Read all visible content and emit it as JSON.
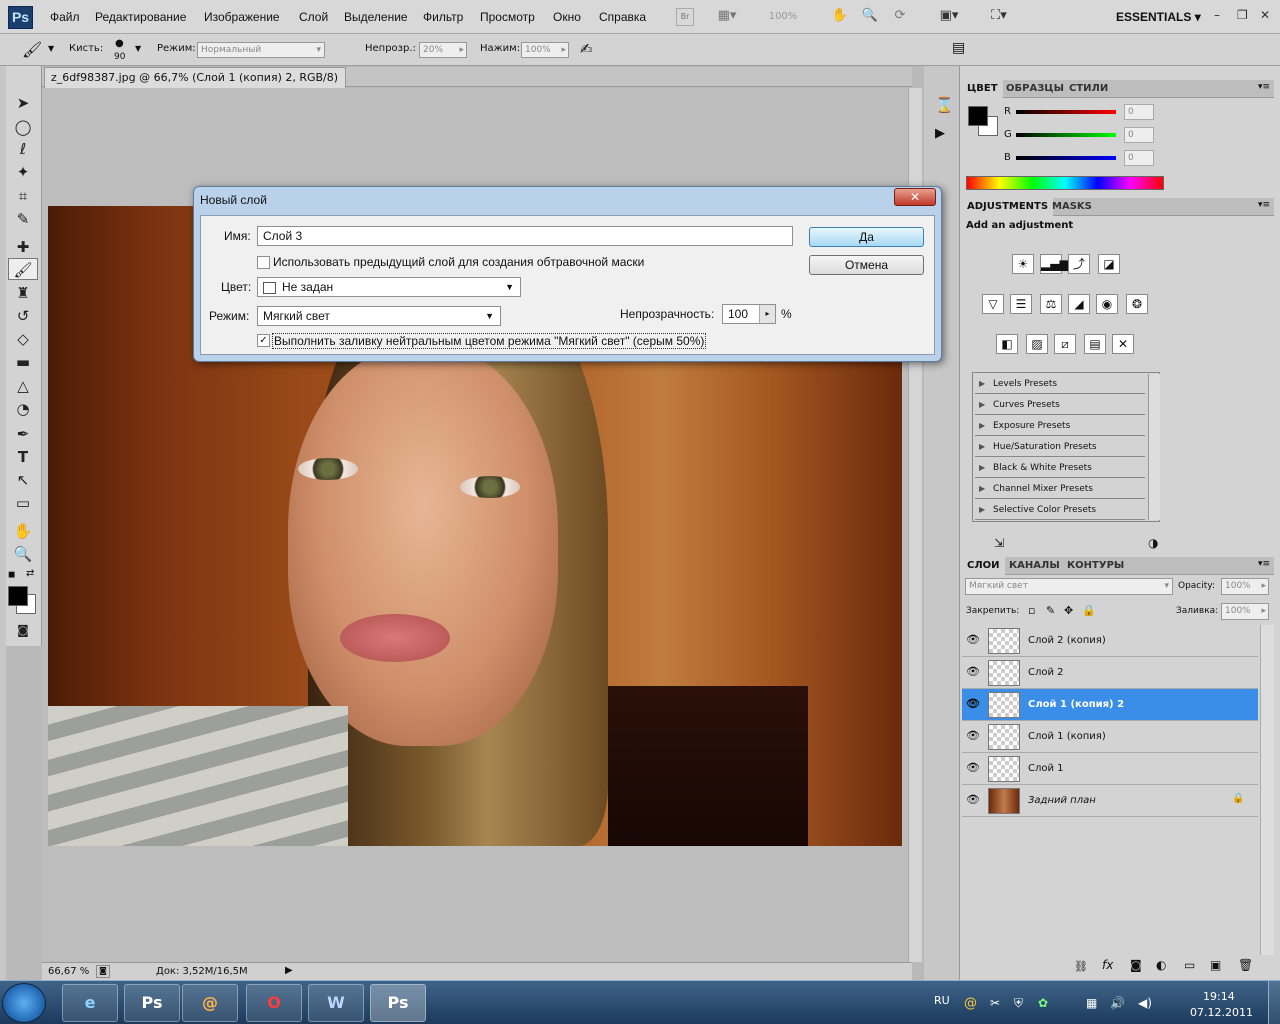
{
  "menubar": {
    "logo": "Ps",
    "items": [
      "Файл",
      "Редактирование",
      "Изображение",
      "Слой",
      "Выделение",
      "Фильтр",
      "Просмотр",
      "Окно",
      "Справка"
    ],
    "zoom": "100%",
    "workspace": "ESSENTIALS"
  },
  "options": {
    "brush_label": "Кисть:",
    "brush_size": "90",
    "mode_label": "Режим:",
    "mode_value": "Нормальный",
    "opacity_label": "Непрозр.:",
    "opacity_value": "20%",
    "pressure_label": "Нажим:",
    "pressure_value": "100%"
  },
  "document": {
    "tab_title": "z_6df98387.jpg @ 66,7% (Слой 1 (копия) 2, RGB/8) *",
    "close": "✕",
    "zoom": "66,67 %",
    "doc_size": "Док: 3,52M/16,5M"
  },
  "color_panel": {
    "tabs": [
      "ЦВЕТ",
      "ОБРАЗЦЫ",
      "СТИЛИ"
    ],
    "r_label": "R",
    "g_label": "G",
    "b_label": "B",
    "r_value": "0",
    "g_value": "0",
    "b_value": "0"
  },
  "adjustments": {
    "tabs": [
      "ADJUSTMENTS",
      "MASKS"
    ],
    "heading": "Add an adjustment",
    "presets": [
      "Levels Presets",
      "Curves Presets",
      "Exposure Presets",
      "Hue/Saturation Presets",
      "Black & White Presets",
      "Channel Mixer Presets",
      "Selective Color Presets"
    ]
  },
  "layers_panel": {
    "tabs": [
      "СЛОИ",
      "КАНАЛЫ",
      "КОНТУРЫ"
    ],
    "blend_mode": "Мягкий свет",
    "opacity_label": "Opacity:",
    "opacity_value": "100%",
    "lock_label": "Закрепить:",
    "fill_label": "Заливка:",
    "fill_value": "100%",
    "layers": [
      "Слой 2 (копия)",
      "Слой 2",
      "Слой 1 (копия) 2",
      "Слой 1 (копия)",
      "Слой 1",
      "Задний план"
    ],
    "selected_index": 2
  },
  "dialog": {
    "title": "Новый слой",
    "name_label": "Имя:",
    "name_value": "Слой 3",
    "clip_checkbox": "Использовать предыдущий слой для создания обтравочной маски",
    "color_label": "Цвет:",
    "color_value": "Не задан",
    "mode_label": "Режим:",
    "mode_value": "Мягкий свет",
    "opacity_label": "Непрозрачность:",
    "opacity_value": "100",
    "opacity_unit": "%",
    "fill_checkbox": "Выполнить заливку нейтральным цветом режима \"Мягкий свет\" (серым 50%)",
    "ok": "Да",
    "cancel": "Отмена"
  },
  "taskbar": {
    "lang": "RU",
    "time": "19:14",
    "date": "07.12.2011"
  },
  "colors": {
    "selection": "#3a8ee8",
    "dialog_frame": "#b9d1ea"
  }
}
